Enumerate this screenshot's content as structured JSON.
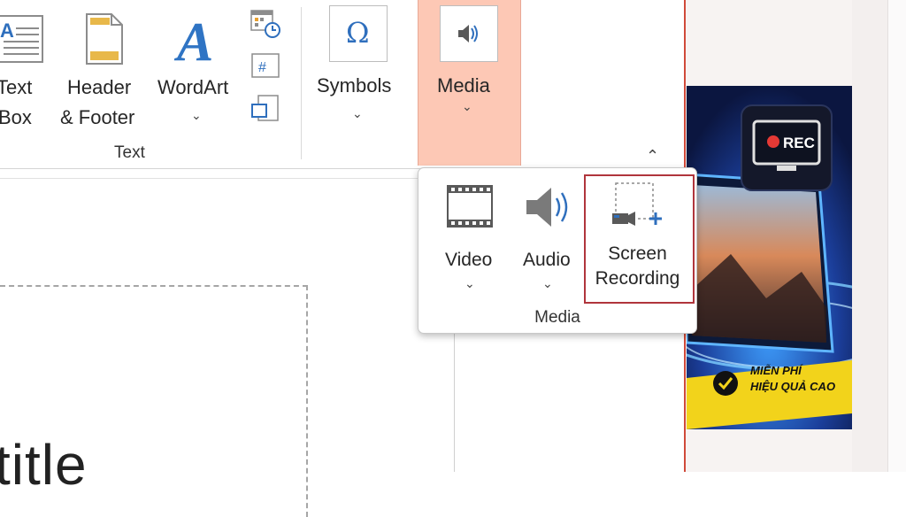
{
  "ribbon": {
    "text_box": {
      "line1": "Text",
      "line2": "Box"
    },
    "header_footer": {
      "line1": "Header",
      "line2": "& Footer"
    },
    "wordart": {
      "label": "WordArt",
      "chevron": "⌄"
    },
    "small_icons": [
      "date-time-icon",
      "slide-number-icon",
      "object-icon"
    ],
    "text_group_label": "Text",
    "symbols": {
      "label": "Symbols",
      "chevron": "⌄",
      "glyph": "Ω"
    },
    "media": {
      "label": "Media",
      "chevron": "⌄",
      "highlight_color": "#fdc8b5"
    },
    "collapse_glyph": "⌃"
  },
  "media_dropdown": {
    "items": [
      {
        "label": "Video",
        "chevron": "⌄",
        "icon": "film-strip-icon"
      },
      {
        "label": "Audio",
        "chevron": "⌄",
        "icon": "speaker-icon"
      },
      {
        "line1": "Screen",
        "line2": "Recording",
        "icon": "screen-recording-icon",
        "selected": true
      }
    ],
    "group_label": "Media",
    "selection_color": "#b0353c"
  },
  "slide": {
    "title_fragment": "title"
  },
  "banner": {
    "rec_label": "REC",
    "promo_line1": "MIỄN PHÍ",
    "promo_line2": "HIỆU QUẢ CAO"
  }
}
